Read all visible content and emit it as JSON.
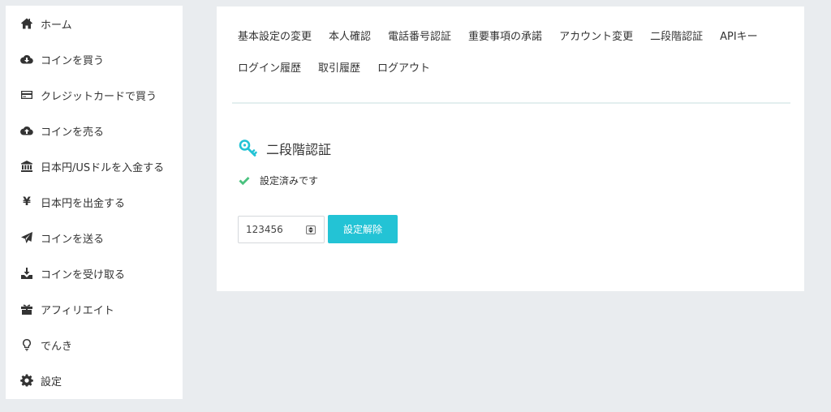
{
  "sidebar": {
    "items": [
      {
        "label": "ホーム",
        "icon": "home-icon"
      },
      {
        "label": "コインを買う",
        "icon": "cloud-download-icon"
      },
      {
        "label": "クレジットカードで買う",
        "icon": "credit-card-icon"
      },
      {
        "label": "コインを売る",
        "icon": "cloud-upload-icon"
      },
      {
        "label": "日本円/USドルを入金する",
        "icon": "bank-icon"
      },
      {
        "label": "日本円を出金する",
        "icon": "yen-icon",
        "glyph": "¥"
      },
      {
        "label": "コインを送る",
        "icon": "send-icon"
      },
      {
        "label": "コインを受け取る",
        "icon": "download-tray-icon"
      },
      {
        "label": "アフィリエイト",
        "icon": "gift-icon"
      },
      {
        "label": "でんき",
        "icon": "lightbulb-icon"
      },
      {
        "label": "設定",
        "icon": "gear-icon"
      }
    ]
  },
  "nav": {
    "links": [
      "基本設定の変更",
      "本人確認",
      "電話番号認証",
      "重要事項の承諾",
      "アカウント変更",
      "二段階認証",
      "APIキー",
      "ログイン履歴",
      "取引履歴",
      "ログアウト"
    ]
  },
  "main": {
    "title": "二段階認証",
    "title_icon": "key-icon",
    "status_text": "設定済みです",
    "status_icon": "check-icon",
    "code_value": "123456",
    "submit_label": "設定解除",
    "accent_color": "#23c3d5",
    "check_color": "#4bc27f"
  }
}
